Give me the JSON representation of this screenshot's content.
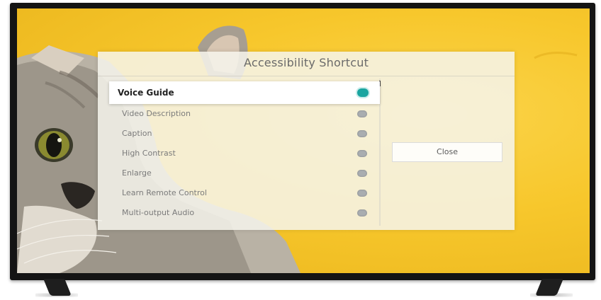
{
  "dialog": {
    "title": "Accessibility Shortcut",
    "items": [
      {
        "label": "Voice Guide",
        "enabled": true,
        "focused": true
      },
      {
        "label": "Video Description",
        "enabled": false,
        "focused": false
      },
      {
        "label": "Caption",
        "enabled": false,
        "focused": false
      },
      {
        "label": "High Contrast",
        "enabled": false,
        "focused": false
      },
      {
        "label": "Enlarge",
        "enabled": false,
        "focused": false
      },
      {
        "label": "Learn Remote Control",
        "enabled": false,
        "focused": false
      },
      {
        "label": "Multi-output Audio",
        "enabled": false,
        "focused": false
      }
    ],
    "close_label": "Close"
  },
  "colors": {
    "toggle_on": "#1aa5a0",
    "toggle_off": "#a9adb0",
    "background": "#f7c72c"
  },
  "icons": [
    "toggle-on-icon",
    "toggle-off-icon"
  ]
}
